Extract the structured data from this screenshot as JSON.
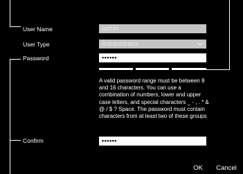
{
  "form": {
    "user_name": {
      "label": "User Name",
      "value": "admin"
    },
    "user_type": {
      "label": "User Type",
      "value": "Administrator"
    },
    "password": {
      "label": "Password",
      "value": "••••••"
    },
    "password_hint": "A valid password range must be between 8 and 16 characters. You can use a combination of numbers, lower and upper case letters, and special characters _ - , . * & @ / $ ? Space. The password must contain characters from at least two of these groups",
    "confirm": {
      "label": "Confirm",
      "value": "••••••"
    }
  },
  "buttons": {
    "ok_label": "OK",
    "cancel_label": "Cancel"
  },
  "colors": {
    "background": "#000000",
    "text": "#ffffff",
    "disabled_field": "#c4c4c4",
    "active_field": "#ffffff"
  }
}
